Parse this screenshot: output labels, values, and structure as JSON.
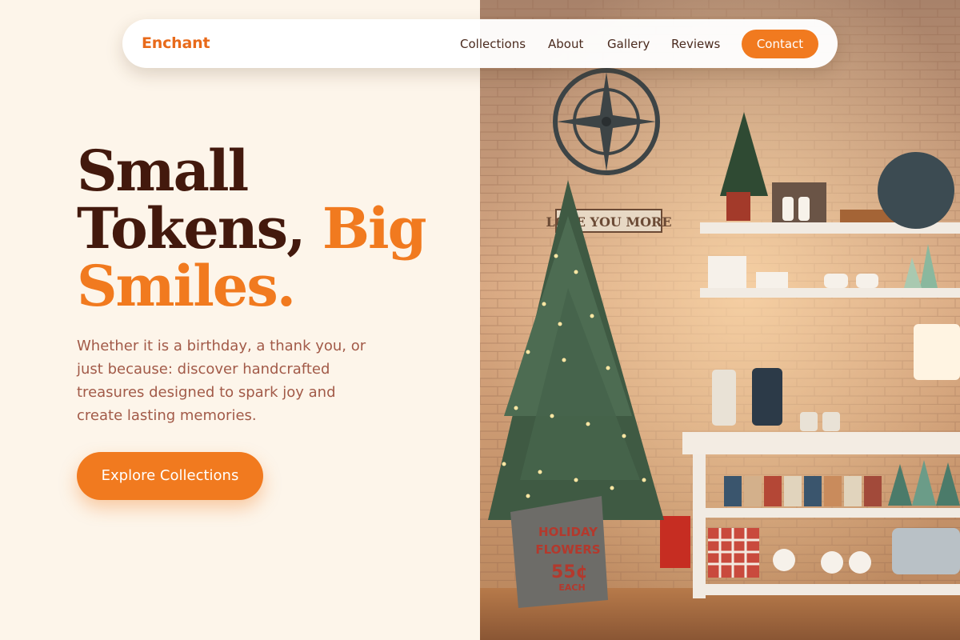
{
  "brand": {
    "name": "Enchant"
  },
  "nav": {
    "links": [
      "Collections",
      "About",
      "Gallery",
      "Reviews"
    ],
    "contact_label": "Contact"
  },
  "hero": {
    "headline_line1": "Small",
    "headline_line2_a": "Tokens, ",
    "headline_line2_b": "Big",
    "headline_line3": "Smiles.",
    "description": "Whether it is a birthday, a thank you, or just because: discover handcrafted treasures designed to spark joy and create lasting memories.",
    "cta_label": "Explore Collections"
  },
  "photo": {
    "sign_text": "LOVE YOU MORE",
    "bucket_text": [
      "HOLIDAY",
      "FLOWERS",
      "55¢",
      "EACH"
    ]
  },
  "colors": {
    "accent": "#f17a1f",
    "dark": "#43190d",
    "background": "#fdf5ea",
    "body_text": "#a25a48"
  }
}
